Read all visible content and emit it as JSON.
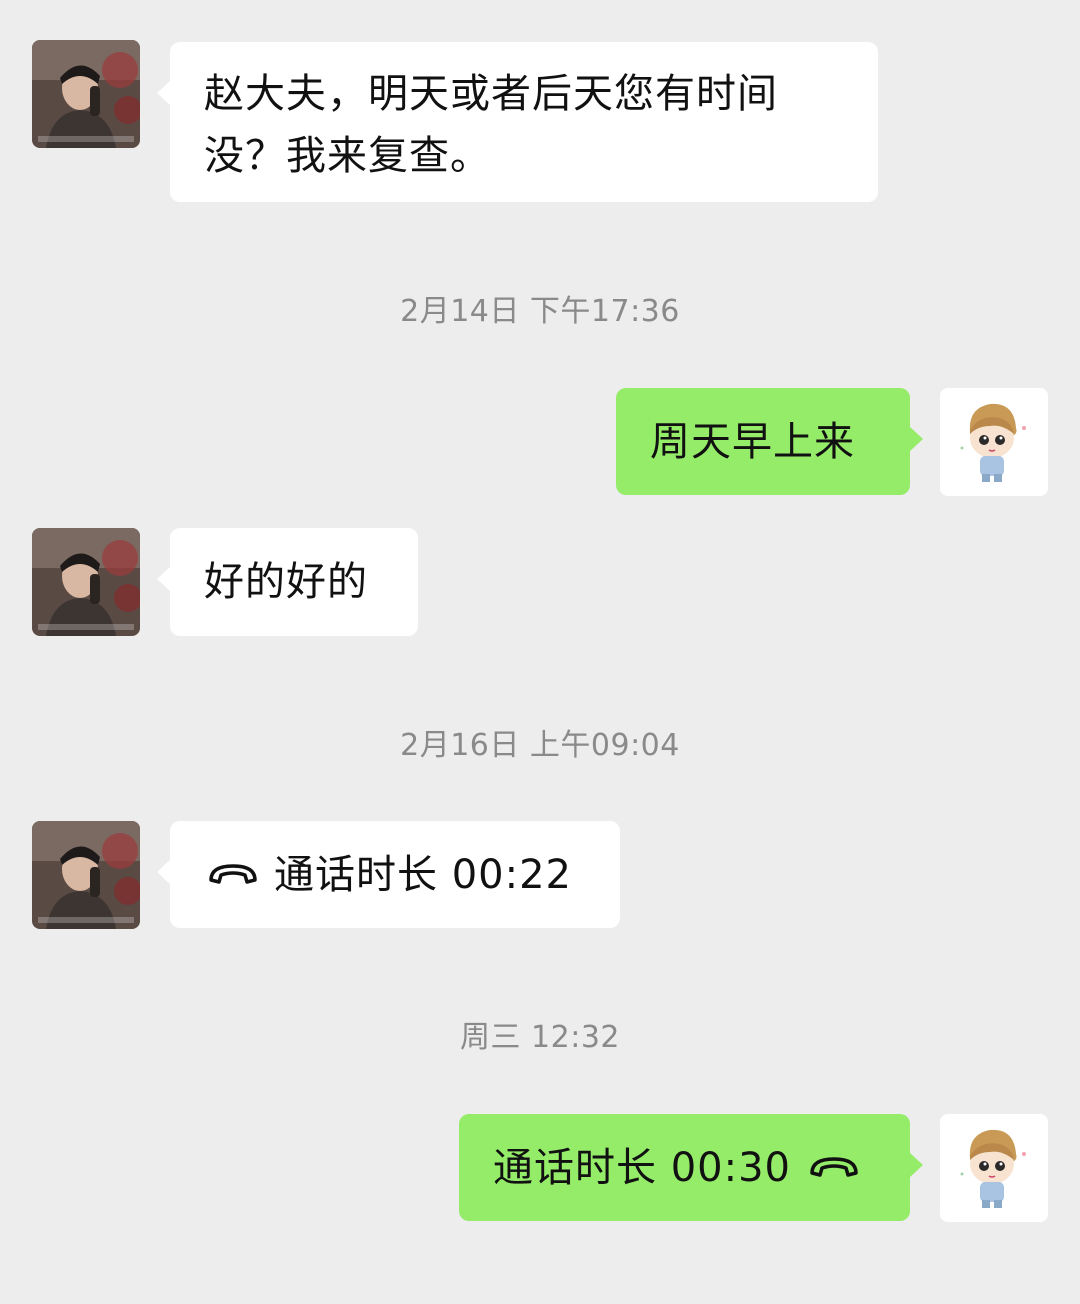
{
  "messages": [
    {
      "side": "left",
      "lines": [
        "赵大夫，明天或者后天您有时间",
        "没？我来复查。"
      ]
    },
    {
      "side": "right",
      "text": "周天早上来"
    },
    {
      "side": "left",
      "text": "好的好的"
    },
    {
      "side": "left",
      "type": "call",
      "label": "通话时长 00:22"
    },
    {
      "side": "right",
      "type": "call",
      "label": "通话时长 00:30"
    }
  ],
  "timestamps": [
    "2月14日 下午17:36",
    "2月16日 上午09:04",
    "周三 12:32"
  ],
  "icons": {
    "call": "phone-handset-icon"
  },
  "colors": {
    "background": "#ededed",
    "bubble_left": "#ffffff",
    "bubble_right": "#95ec69",
    "timestamp": "#8a8a8a"
  }
}
